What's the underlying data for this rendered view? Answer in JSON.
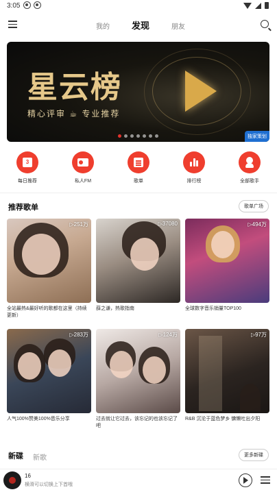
{
  "status_bar": {
    "time": "3:05",
    "left_icons": [
      "netease-notification-icon",
      "netease-notification-icon"
    ],
    "right_icons": [
      "wifi-icon",
      "signal-icon",
      "battery-icon"
    ]
  },
  "top_nav": {
    "tabs": [
      {
        "label": "我的",
        "active": false
      },
      {
        "label": "发现",
        "active": true
      },
      {
        "label": "朋友",
        "active": false
      }
    ]
  },
  "banner": {
    "title": "星云榜",
    "subtitle": "精心评审 ☕ 专业推荐",
    "badge": "独家策划",
    "slide_count": 7,
    "active_slide": 1,
    "accent_color": "#e2322b"
  },
  "quick_entries": [
    {
      "label": "每日推荐",
      "icon": "calendar-icon"
    },
    {
      "label": "私人FM",
      "icon": "radio-icon"
    },
    {
      "label": "歌单",
      "icon": "playlist-icon"
    },
    {
      "label": "排行榜",
      "icon": "chart-bars-icon"
    },
    {
      "label": "全部歌手",
      "icon": "singer-icon"
    }
  ],
  "recommended": {
    "title": "推荐歌单",
    "more_label": "歌单广场",
    "playlists": [
      {
        "plays": "▷251万",
        "title": "全站最热&最好听的歌都在这里（持续更新）"
      },
      {
        "plays": "▷37080",
        "title": "薛之谦，热歌指南"
      },
      {
        "plays": "▷494万",
        "title": "全球数字音乐销量TOP100"
      },
      {
        "plays": "▷283万",
        "title": "人气100%赞美100%音乐分享"
      },
      {
        "plays": "▷124万",
        "title": "过去就让它过去，该忘记的也该忘记了吧"
      },
      {
        "plays": "▷97万",
        "title": "R&B 沉沦于蓝色梦乡 慵懒吐出夕阳"
      }
    ]
  },
  "new_releases": {
    "title": "新碟",
    "sub_tab": "新歌",
    "more_label": "更多新碟"
  },
  "mini_player": {
    "title": "16",
    "subtitle": "横滑可以切换上下首哦"
  }
}
